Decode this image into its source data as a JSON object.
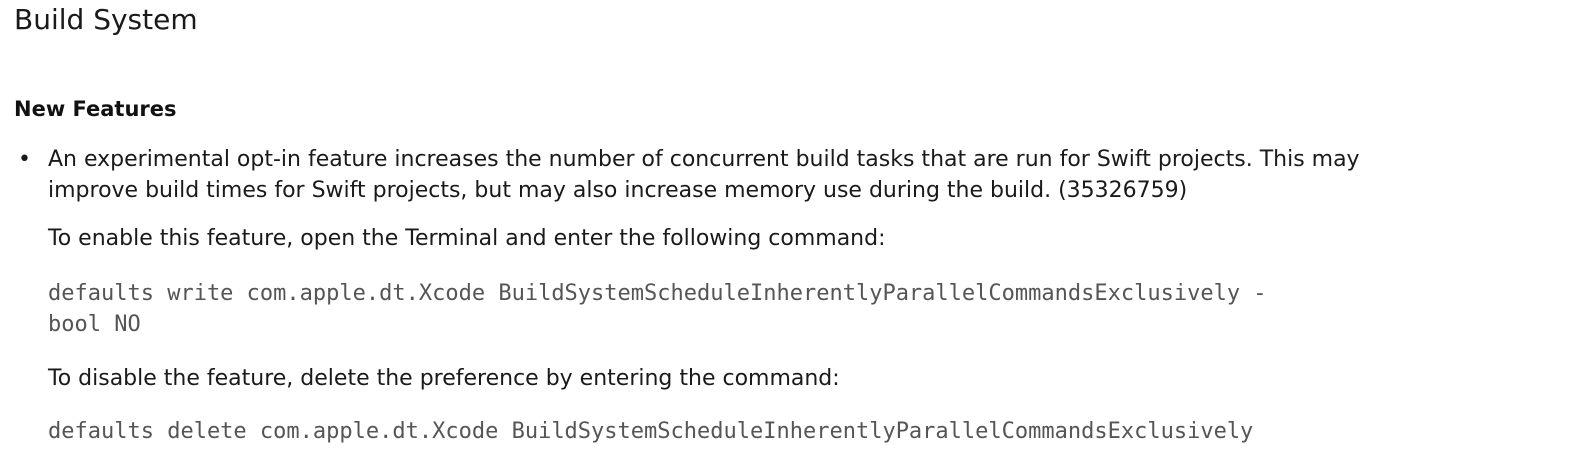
{
  "section": {
    "title": "Build System",
    "subtitle": "New Features"
  },
  "item": {
    "bullet": "•",
    "line1": "An experimental opt-in feature increases the number of concurrent build tasks that are run for Swift projects. This may",
    "line2": "improve build times for Swift projects, but may also increase memory use during the build. (35326759)",
    "enable_text": "To enable this feature, open the Terminal and enter the following command:",
    "enable_cmd_line1": "defaults write com.apple.dt.Xcode BuildSystemScheduleInherentlyParallelCommandsExclusively -",
    "enable_cmd_line2": "bool NO",
    "disable_text": "To disable the feature, delete the preference by entering the command:",
    "disable_cmd": "defaults delete com.apple.dt.Xcode BuildSystemScheduleInherentlyParallelCommandsExclusively"
  }
}
